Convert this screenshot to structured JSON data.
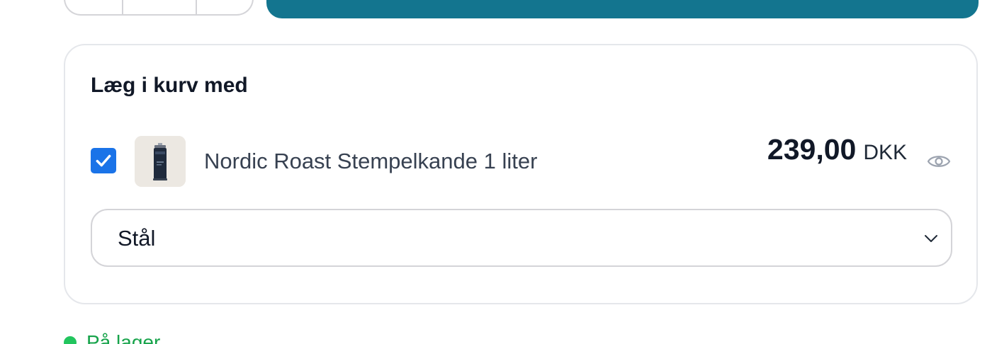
{
  "bundle": {
    "title": "Læg i kurv med",
    "item": {
      "checked": true,
      "name": "Nordic Roast Stempelkande 1 liter",
      "price": "239,00",
      "currency": "DKK",
      "variant": "Stål",
      "icon": "eye-icon"
    }
  },
  "stock": {
    "label": "På lager",
    "color": "#22c55e"
  },
  "colors": {
    "accent": "#13758f",
    "checkbox": "#1a73e8"
  }
}
